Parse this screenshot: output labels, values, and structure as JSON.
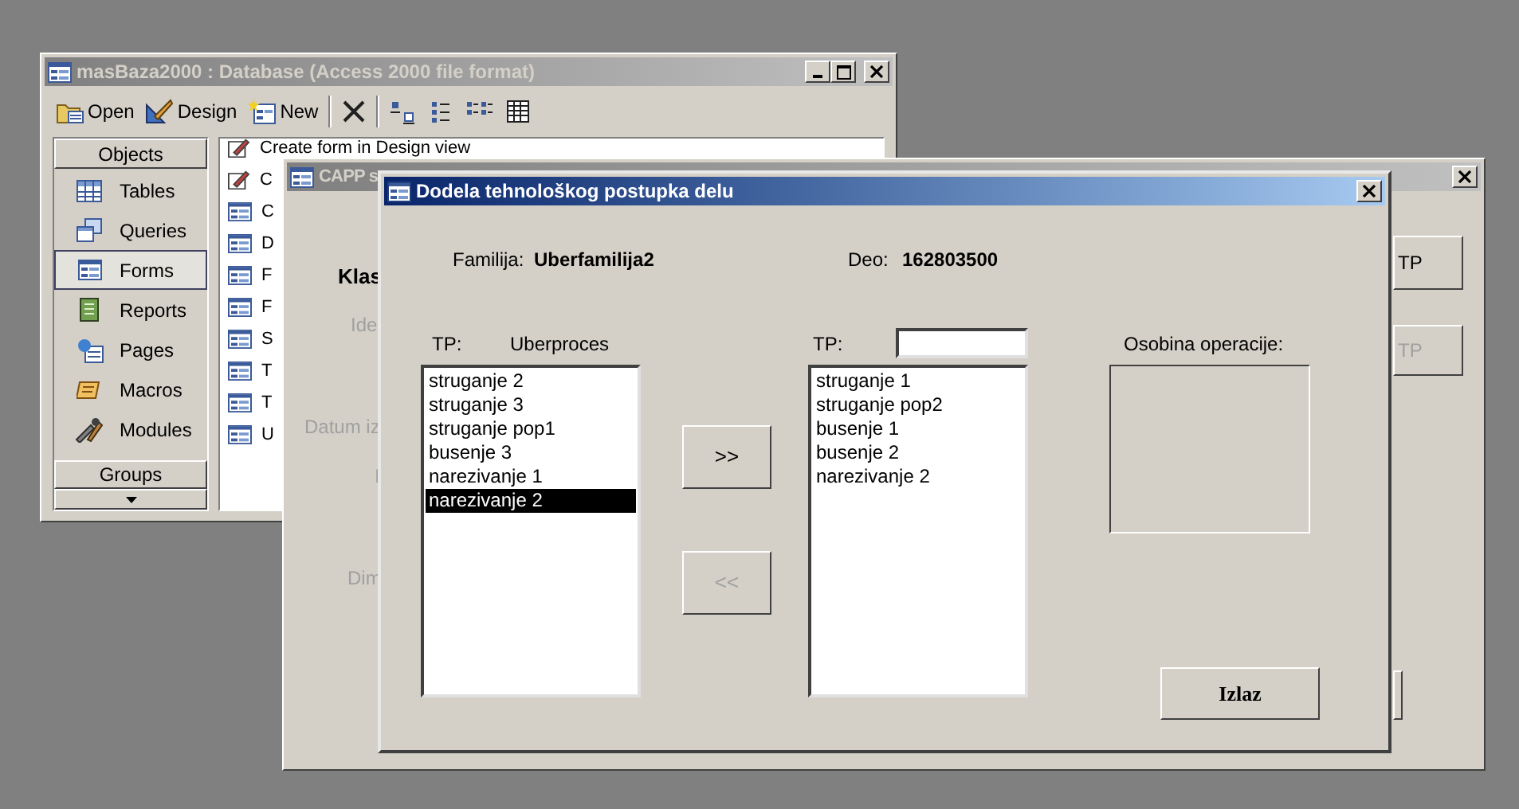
{
  "database_window": {
    "title": "masBaza2000 : Database (Access 2000 file format)",
    "active": false,
    "toolbar": [
      {
        "kind": "open",
        "label": "Open"
      },
      {
        "kind": "design",
        "label": "Design"
      },
      {
        "kind": "new",
        "label": "New"
      },
      {
        "kind": "separator"
      },
      {
        "kind": "delete"
      },
      {
        "kind": "separator"
      },
      {
        "kind": "large_icons"
      },
      {
        "kind": "small_icons"
      },
      {
        "kind": "list"
      },
      {
        "kind": "details"
      }
    ],
    "objects_header": "Objects",
    "objects": [
      {
        "kind": "tables",
        "label": "Tables",
        "selected": false
      },
      {
        "kind": "queries",
        "label": "Queries",
        "selected": false
      },
      {
        "kind": "forms",
        "label": "Forms",
        "selected": true
      },
      {
        "kind": "reports",
        "label": "Reports",
        "selected": false
      },
      {
        "kind": "pages",
        "label": "Pages",
        "selected": false
      },
      {
        "kind": "macros",
        "label": "Macros",
        "selected": false
      },
      {
        "kind": "modules",
        "label": "Modules",
        "selected": false
      }
    ],
    "groups_header": "Groups",
    "items": [
      {
        "kind": "shortcut",
        "label": "Create form in Design view"
      },
      {
        "kind": "shortcut",
        "label": "C"
      },
      {
        "kind": "form",
        "label": "C"
      },
      {
        "kind": "form",
        "label": "D"
      },
      {
        "kind": "form",
        "label": "F"
      },
      {
        "kind": "form",
        "label": "F"
      },
      {
        "kind": "form",
        "label": "S"
      },
      {
        "kind": "form",
        "label": "T"
      },
      {
        "kind": "form",
        "label": "T"
      },
      {
        "kind": "form",
        "label": "U"
      }
    ]
  },
  "capp_window": {
    "title": "CAPP s",
    "active": false,
    "labels": [
      {
        "kind": "heading",
        "text": "Klas"
      },
      {
        "kind": "disabled",
        "text": "Ide"
      },
      {
        "kind": "disabled",
        "text": "Datum iz"
      },
      {
        "kind": "disabled",
        "text": "I"
      },
      {
        "kind": "disabled",
        "text": "Dim"
      }
    ],
    "buttons": [
      {
        "label": "TP",
        "disabled": false
      },
      {
        "label": "TP",
        "disabled": true
      }
    ]
  },
  "dialog": {
    "title": "Dodela tehnološkog postupka delu",
    "active": true,
    "familija_label": "Familija:",
    "familija_value": "Uberfamilija2",
    "deo_label": "Deo:",
    "deo_value": "162803500",
    "left_list": {
      "label": "TP:",
      "value": "Uberproces",
      "items": [
        {
          "text": "struganje 2",
          "selected": false
        },
        {
          "text": "struganje 3",
          "selected": false
        },
        {
          "text": "struganje pop1",
          "selected": false
        },
        {
          "text": "busenje 3",
          "selected": false
        },
        {
          "text": "narezivanje 1",
          "selected": false
        },
        {
          "text": "narezivanje 2",
          "selected": true
        }
      ]
    },
    "add_button": {
      "label": ">>",
      "disabled": false
    },
    "remove_button": {
      "label": "<<",
      "disabled": true
    },
    "right_list": {
      "label": "TP:",
      "items": [
        {
          "text": "struganje 1",
          "selected": false
        },
        {
          "text": "struganje pop2",
          "selected": false
        },
        {
          "text": "busenje 1",
          "selected": false
        },
        {
          "text": "busenje 2",
          "selected": false
        },
        {
          "text": "narezivanje 2",
          "selected": false
        }
      ]
    },
    "property_label": "Osobina operacije:",
    "exit_button": {
      "label": "Izlaz"
    }
  }
}
